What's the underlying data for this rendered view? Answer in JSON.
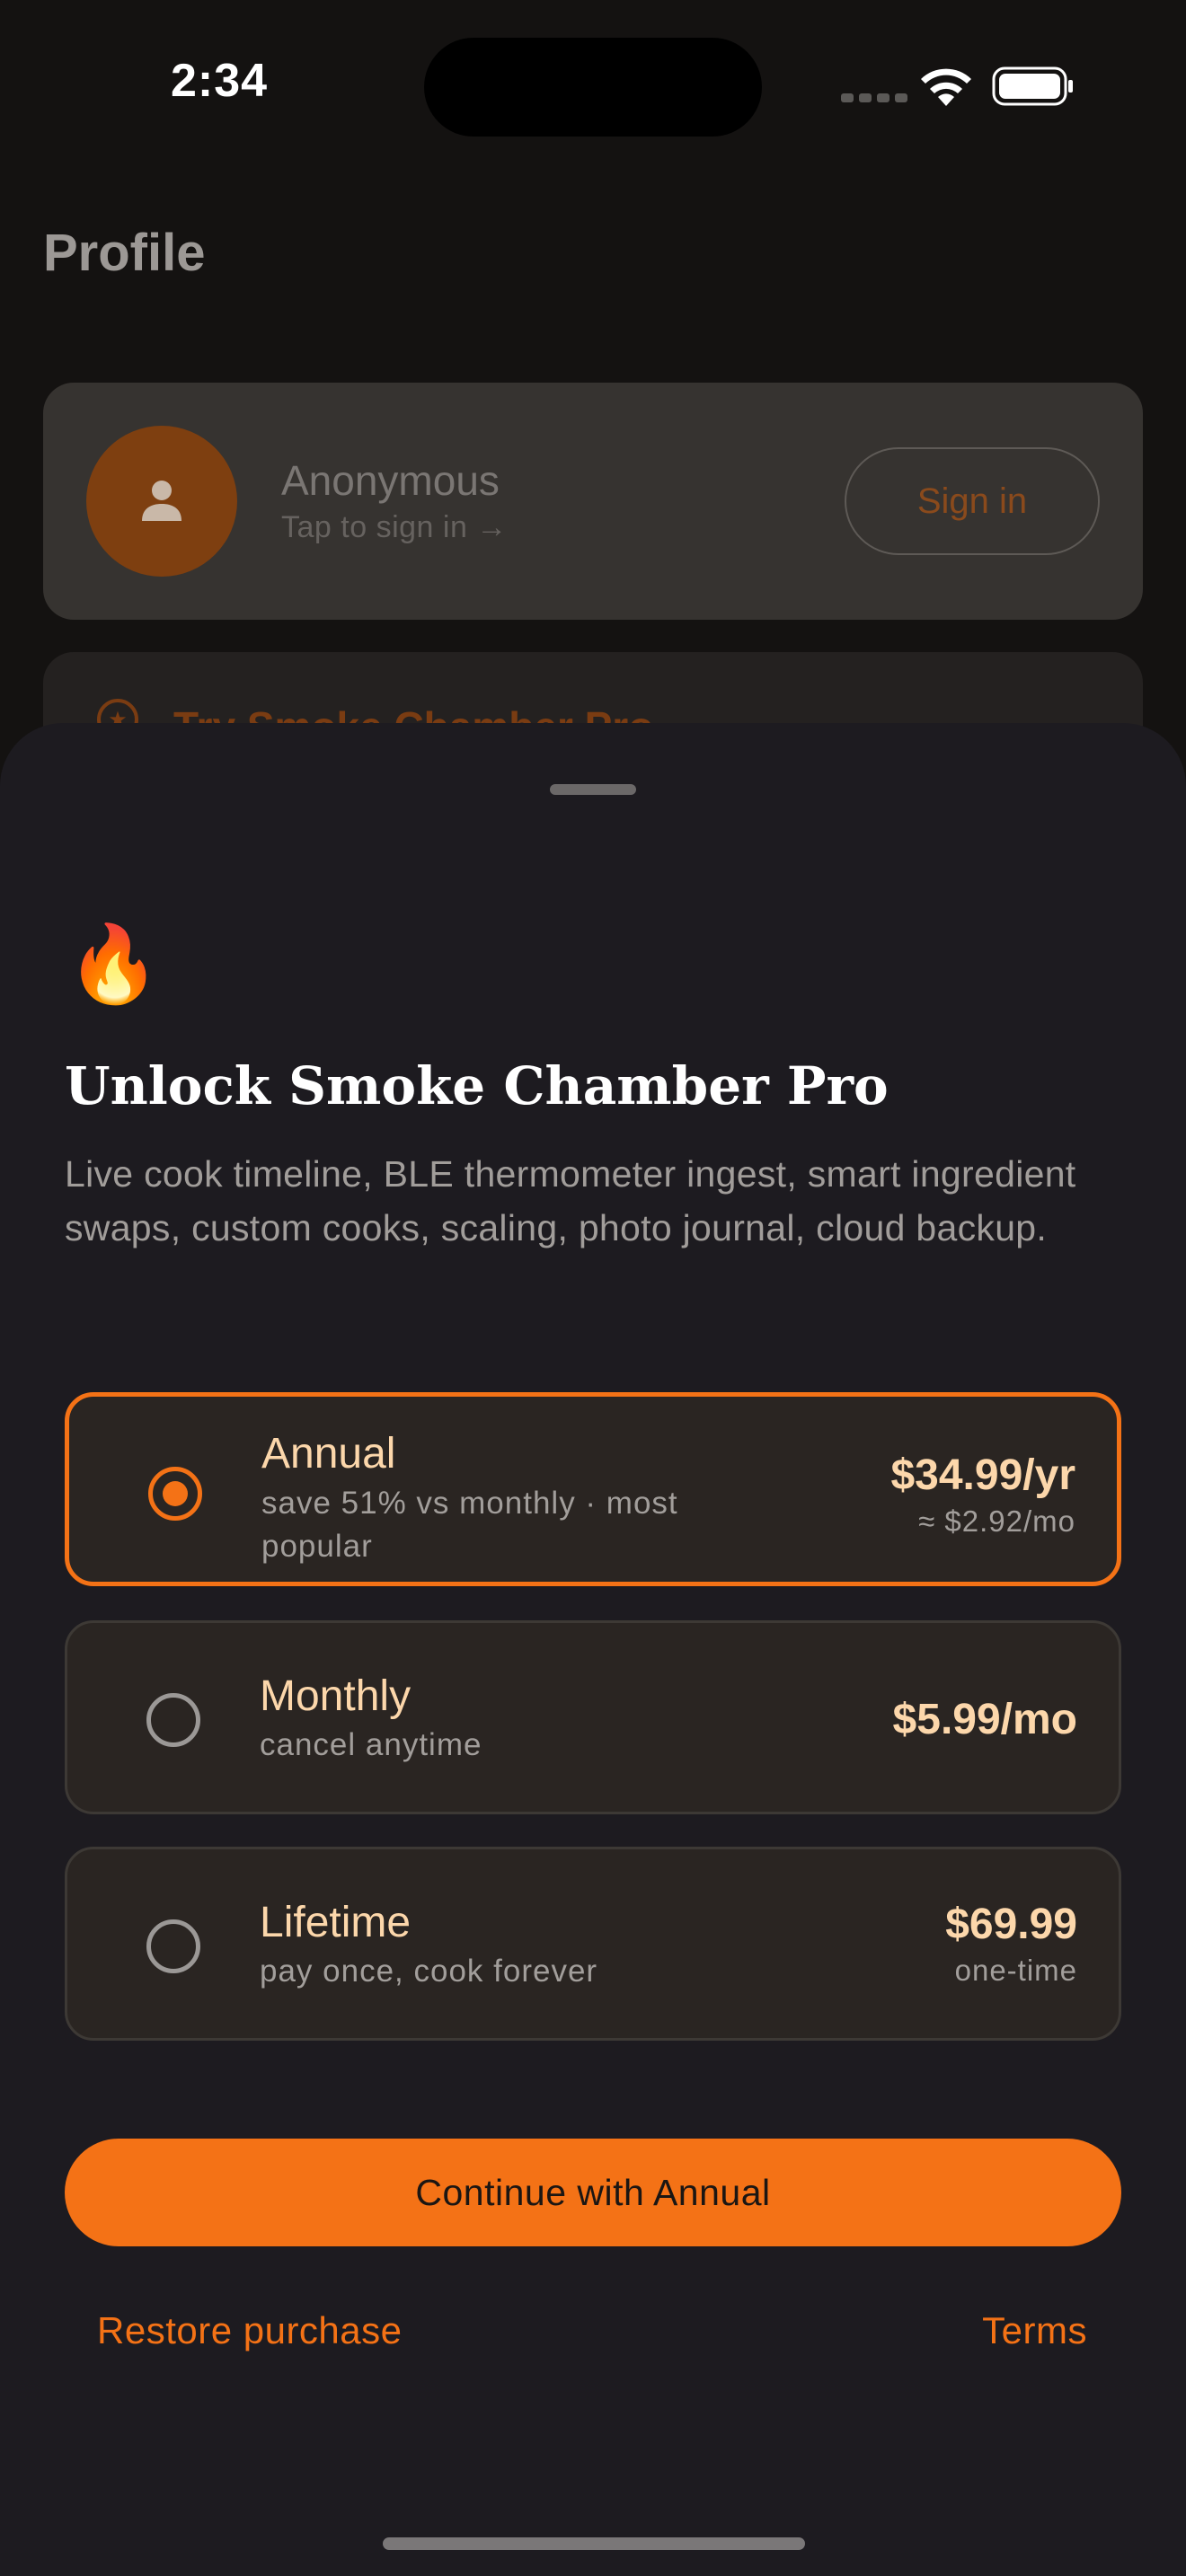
{
  "status_bar": {
    "time": "2:34"
  },
  "profile": {
    "title": "Profile",
    "user_name": "Anonymous",
    "user_sub": "Tap to sign in →",
    "sign_in_label": "Sign in",
    "pro_card_title": "Try Smoke Chamber Pro"
  },
  "sheet": {
    "icon": "fire-emoji",
    "icon_glyph": "🔥",
    "title": "Unlock Smoke Chamber Pro",
    "description": "Live cook timeline, BLE thermometer ingest, smart ingredient swaps, custom cooks, scaling, photo journal, cloud backup.",
    "plans": [
      {
        "name": "Annual",
        "sub": "save 51% vs monthly · most popular",
        "price": "$34.99/yr",
        "note": "≈ $2.92/mo",
        "selected": true
      },
      {
        "name": "Monthly",
        "sub": "cancel anytime",
        "price": "$5.99/mo",
        "note": "",
        "selected": false
      },
      {
        "name": "Lifetime",
        "sub": "pay once, cook forever",
        "price": "$69.99",
        "note": "one-time",
        "selected": false
      }
    ],
    "cta_label": "Continue with Annual",
    "restore_label": "Restore purchase",
    "terms_label": "Terms"
  },
  "colors": {
    "accent": "#f47216",
    "accent_text": "#fcd7ab",
    "sheet_bg": "#1d1b20",
    "page_bg": "#141211"
  }
}
